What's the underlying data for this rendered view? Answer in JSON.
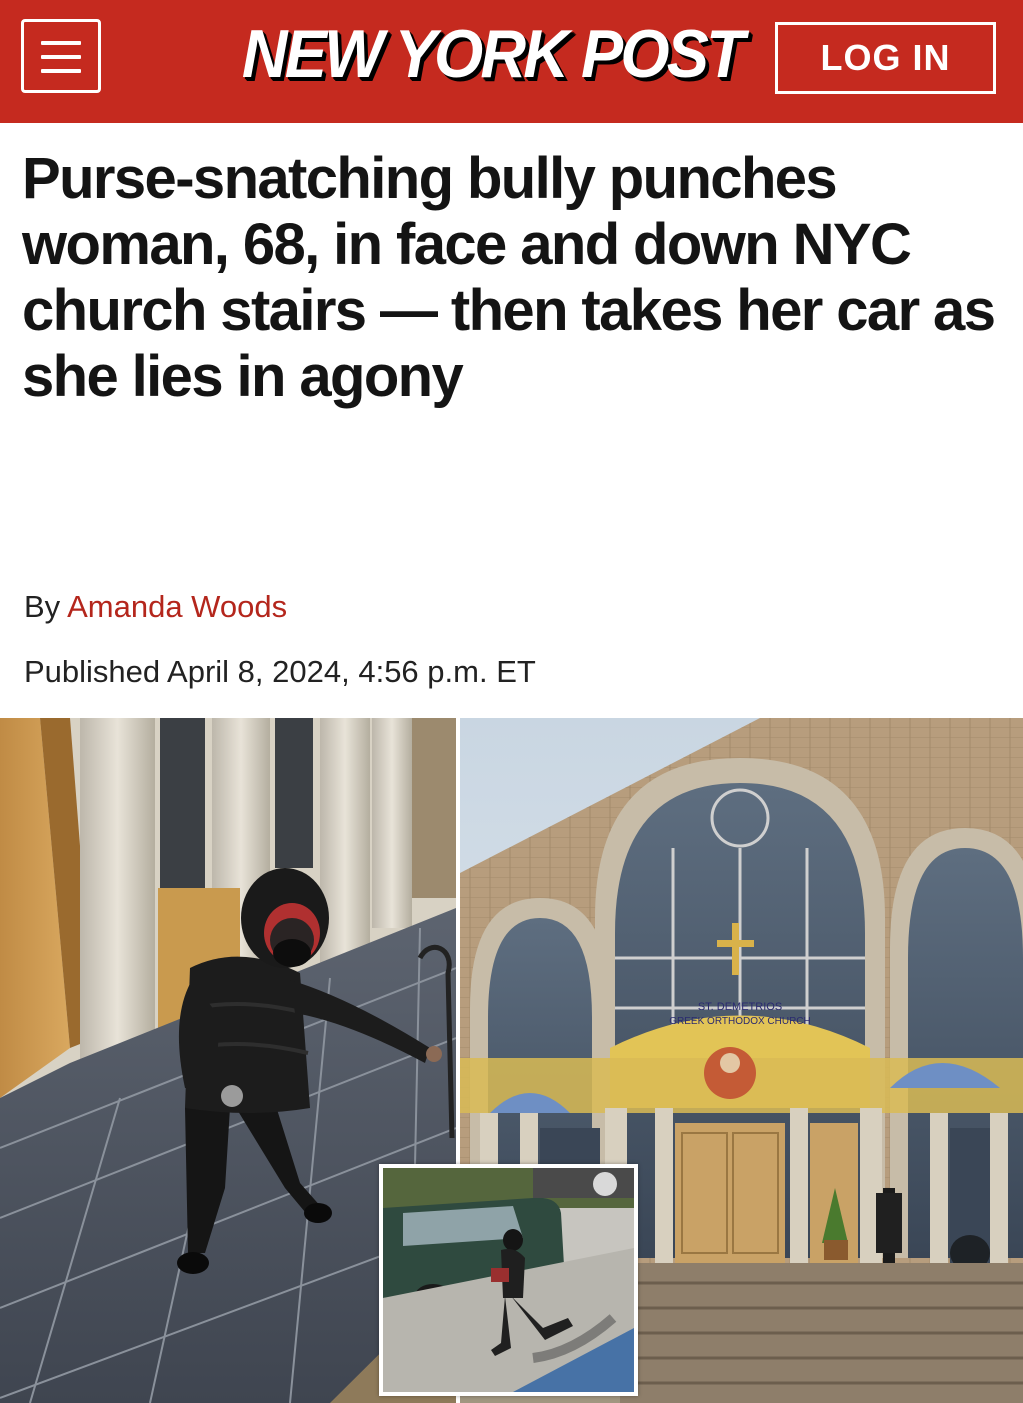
{
  "header": {
    "brand": "NEW YORK POST",
    "login_label": "LOG IN",
    "brand_color": "#c52a1f"
  },
  "article": {
    "headline": "Purse-snatching bully punches woman, 68, in face and down NYC church stairs — then takes her car as she lies in agony",
    "byline_prefix": "By",
    "author": "Amanda Woods",
    "published": "Published April 8, 2024, 4:56 p.m. ET"
  },
  "photos": {
    "church_sign_line1": "ST. DEMETRIOS",
    "church_sign_line2": "GREEK ORTHODOX CHURCH"
  },
  "icons": {
    "menu": "hamburger-menu-icon"
  }
}
